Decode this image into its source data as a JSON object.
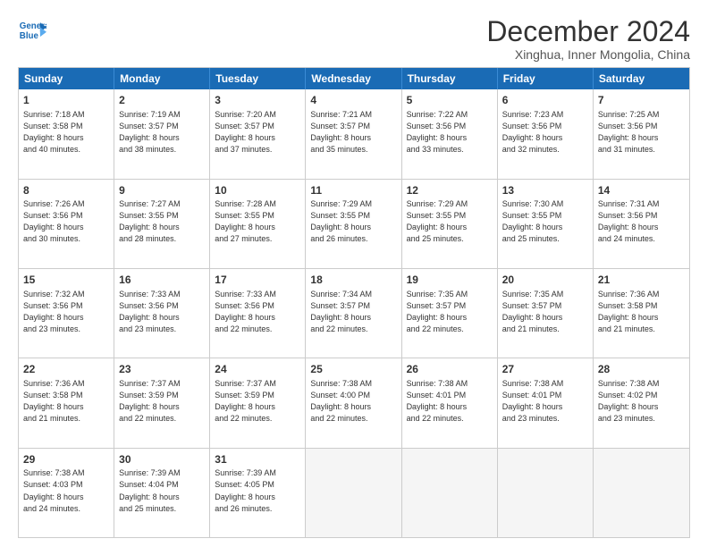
{
  "header": {
    "logo_line1": "General",
    "logo_line2": "Blue",
    "title": "December 2024",
    "subtitle": "Xinghua, Inner Mongolia, China"
  },
  "days": [
    "Sunday",
    "Monday",
    "Tuesday",
    "Wednesday",
    "Thursday",
    "Friday",
    "Saturday"
  ],
  "rows": [
    [
      {
        "day": "1",
        "lines": [
          "Sunrise: 7:18 AM",
          "Sunset: 3:58 PM",
          "Daylight: 8 hours",
          "and 40 minutes."
        ]
      },
      {
        "day": "2",
        "lines": [
          "Sunrise: 7:19 AM",
          "Sunset: 3:57 PM",
          "Daylight: 8 hours",
          "and 38 minutes."
        ]
      },
      {
        "day": "3",
        "lines": [
          "Sunrise: 7:20 AM",
          "Sunset: 3:57 PM",
          "Daylight: 8 hours",
          "and 37 minutes."
        ]
      },
      {
        "day": "4",
        "lines": [
          "Sunrise: 7:21 AM",
          "Sunset: 3:57 PM",
          "Daylight: 8 hours",
          "and 35 minutes."
        ]
      },
      {
        "day": "5",
        "lines": [
          "Sunrise: 7:22 AM",
          "Sunset: 3:56 PM",
          "Daylight: 8 hours",
          "and 33 minutes."
        ]
      },
      {
        "day": "6",
        "lines": [
          "Sunrise: 7:23 AM",
          "Sunset: 3:56 PM",
          "Daylight: 8 hours",
          "and 32 minutes."
        ]
      },
      {
        "day": "7",
        "lines": [
          "Sunrise: 7:25 AM",
          "Sunset: 3:56 PM",
          "Daylight: 8 hours",
          "and 31 minutes."
        ]
      }
    ],
    [
      {
        "day": "8",
        "lines": [
          "Sunrise: 7:26 AM",
          "Sunset: 3:56 PM",
          "Daylight: 8 hours",
          "and 30 minutes."
        ]
      },
      {
        "day": "9",
        "lines": [
          "Sunrise: 7:27 AM",
          "Sunset: 3:55 PM",
          "Daylight: 8 hours",
          "and 28 minutes."
        ]
      },
      {
        "day": "10",
        "lines": [
          "Sunrise: 7:28 AM",
          "Sunset: 3:55 PM",
          "Daylight: 8 hours",
          "and 27 minutes."
        ]
      },
      {
        "day": "11",
        "lines": [
          "Sunrise: 7:29 AM",
          "Sunset: 3:55 PM",
          "Daylight: 8 hours",
          "and 26 minutes."
        ]
      },
      {
        "day": "12",
        "lines": [
          "Sunrise: 7:29 AM",
          "Sunset: 3:55 PM",
          "Daylight: 8 hours",
          "and 25 minutes."
        ]
      },
      {
        "day": "13",
        "lines": [
          "Sunrise: 7:30 AM",
          "Sunset: 3:55 PM",
          "Daylight: 8 hours",
          "and 25 minutes."
        ]
      },
      {
        "day": "14",
        "lines": [
          "Sunrise: 7:31 AM",
          "Sunset: 3:56 PM",
          "Daylight: 8 hours",
          "and 24 minutes."
        ]
      }
    ],
    [
      {
        "day": "15",
        "lines": [
          "Sunrise: 7:32 AM",
          "Sunset: 3:56 PM",
          "Daylight: 8 hours",
          "and 23 minutes."
        ]
      },
      {
        "day": "16",
        "lines": [
          "Sunrise: 7:33 AM",
          "Sunset: 3:56 PM",
          "Daylight: 8 hours",
          "and 23 minutes."
        ]
      },
      {
        "day": "17",
        "lines": [
          "Sunrise: 7:33 AM",
          "Sunset: 3:56 PM",
          "Daylight: 8 hours",
          "and 22 minutes."
        ]
      },
      {
        "day": "18",
        "lines": [
          "Sunrise: 7:34 AM",
          "Sunset: 3:57 PM",
          "Daylight: 8 hours",
          "and 22 minutes."
        ]
      },
      {
        "day": "19",
        "lines": [
          "Sunrise: 7:35 AM",
          "Sunset: 3:57 PM",
          "Daylight: 8 hours",
          "and 22 minutes."
        ]
      },
      {
        "day": "20",
        "lines": [
          "Sunrise: 7:35 AM",
          "Sunset: 3:57 PM",
          "Daylight: 8 hours",
          "and 21 minutes."
        ]
      },
      {
        "day": "21",
        "lines": [
          "Sunrise: 7:36 AM",
          "Sunset: 3:58 PM",
          "Daylight: 8 hours",
          "and 21 minutes."
        ]
      }
    ],
    [
      {
        "day": "22",
        "lines": [
          "Sunrise: 7:36 AM",
          "Sunset: 3:58 PM",
          "Daylight: 8 hours",
          "and 21 minutes."
        ]
      },
      {
        "day": "23",
        "lines": [
          "Sunrise: 7:37 AM",
          "Sunset: 3:59 PM",
          "Daylight: 8 hours",
          "and 22 minutes."
        ]
      },
      {
        "day": "24",
        "lines": [
          "Sunrise: 7:37 AM",
          "Sunset: 3:59 PM",
          "Daylight: 8 hours",
          "and 22 minutes."
        ]
      },
      {
        "day": "25",
        "lines": [
          "Sunrise: 7:38 AM",
          "Sunset: 4:00 PM",
          "Daylight: 8 hours",
          "and 22 minutes."
        ]
      },
      {
        "day": "26",
        "lines": [
          "Sunrise: 7:38 AM",
          "Sunset: 4:01 PM",
          "Daylight: 8 hours",
          "and 22 minutes."
        ]
      },
      {
        "day": "27",
        "lines": [
          "Sunrise: 7:38 AM",
          "Sunset: 4:01 PM",
          "Daylight: 8 hours",
          "and 23 minutes."
        ]
      },
      {
        "day": "28",
        "lines": [
          "Sunrise: 7:38 AM",
          "Sunset: 4:02 PM",
          "Daylight: 8 hours",
          "and 23 minutes."
        ]
      }
    ],
    [
      {
        "day": "29",
        "lines": [
          "Sunrise: 7:38 AM",
          "Sunset: 4:03 PM",
          "Daylight: 8 hours",
          "and 24 minutes."
        ]
      },
      {
        "day": "30",
        "lines": [
          "Sunrise: 7:39 AM",
          "Sunset: 4:04 PM",
          "Daylight: 8 hours",
          "and 25 minutes."
        ]
      },
      {
        "day": "31",
        "lines": [
          "Sunrise: 7:39 AM",
          "Sunset: 4:05 PM",
          "Daylight: 8 hours",
          "and 26 minutes."
        ]
      },
      null,
      null,
      null,
      null
    ]
  ]
}
